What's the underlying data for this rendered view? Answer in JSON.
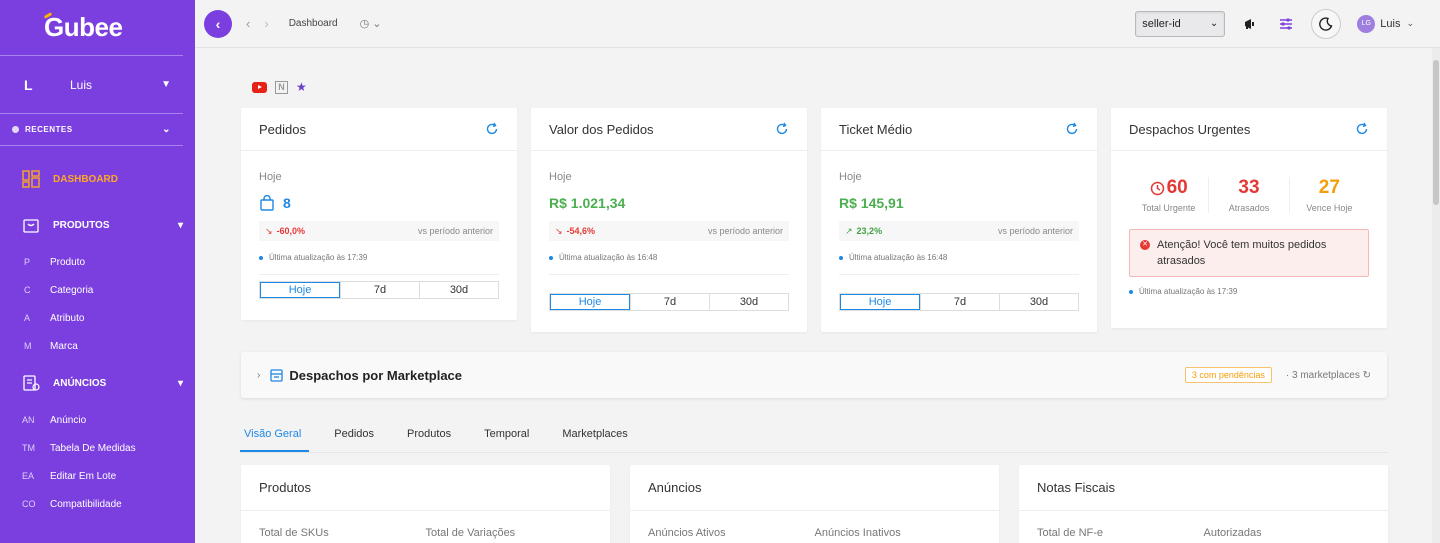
{
  "sidebar": {
    "brand": "Gubee",
    "user": {
      "initial": "L",
      "name": "Luis"
    },
    "recentes": "RECENTES",
    "items": {
      "dashboard": "DASHBOARD",
      "produtos": "PRODUTOS",
      "anuncios": "ANÚNCIOS"
    },
    "produtos_sub": [
      {
        "ab": "P",
        "label": "Produto"
      },
      {
        "ab": "C",
        "label": "Categoria"
      },
      {
        "ab": "A",
        "label": "Atributo"
      },
      {
        "ab": "M",
        "label": "Marca"
      }
    ],
    "anuncios_sub": [
      {
        "ab": "AN",
        "label": "Anúncio"
      },
      {
        "ab": "TM",
        "label": "Tabela De Medidas"
      },
      {
        "ab": "EA",
        "label": "Editar Em Lote"
      },
      {
        "ab": "CO",
        "label": "Compatibilidade"
      }
    ]
  },
  "topbar": {
    "breadcrumb": "Dashboard",
    "seller": "seller-id",
    "user_initials": "LG",
    "user_name": "Luis"
  },
  "cards": {
    "pedidos": {
      "title": "Pedidos",
      "period": "Hoje",
      "value": "8",
      "trend": "-60,0%",
      "vs": "vs período anterior",
      "updated": "Última atualização às 17:39"
    },
    "valor": {
      "title": "Valor dos Pedidos",
      "period": "Hoje",
      "value": "R$ 1.021,34",
      "trend": "-54,6%",
      "vs": "vs período anterior",
      "updated": "Última atualização às 16:48"
    },
    "ticket": {
      "title": "Ticket Médio",
      "period": "Hoje",
      "value": "R$ 145,91",
      "trend": "23,2%",
      "vs": "vs período anterior",
      "updated": "Última atualização às 16:48"
    },
    "despachos": {
      "title": "Despachos Urgentes",
      "total": "60",
      "total_label": "Total Urgente",
      "atrasados": "33",
      "atrasados_label": "Atrasados",
      "vence": "27",
      "vence_label": "Vence Hoje",
      "alert": "Atenção! Você tem muitos pedidos atrasados",
      "updated": "Última atualização às 17:39"
    }
  },
  "segments": [
    "Hoje",
    "7d",
    "30d"
  ],
  "marketplace": {
    "title": "Despachos por Marketplace",
    "pending": "3 com pendências",
    "count": "3 marketplaces"
  },
  "tabs": [
    "Visão Geral",
    "Pedidos",
    "Produtos",
    "Temporal",
    "Marketplaces"
  ],
  "bottom_cards": [
    {
      "title": "Produtos",
      "col1": "Total de SKUs",
      "col2": "Total de Variações"
    },
    {
      "title": "Anúncios",
      "col1": "Anúncios Ativos",
      "col2": "Anúncios Inativos"
    },
    {
      "title": "Notas Fiscais",
      "col1": "Total de NF-e",
      "col2": "Autorizadas"
    }
  ],
  "colors": {
    "brand": "#7b3fe0",
    "accent": "#1e88e5",
    "dashboard_active": "#ffa726",
    "danger": "#e53935",
    "success": "#4caf50",
    "warning": "#f59e0b"
  }
}
